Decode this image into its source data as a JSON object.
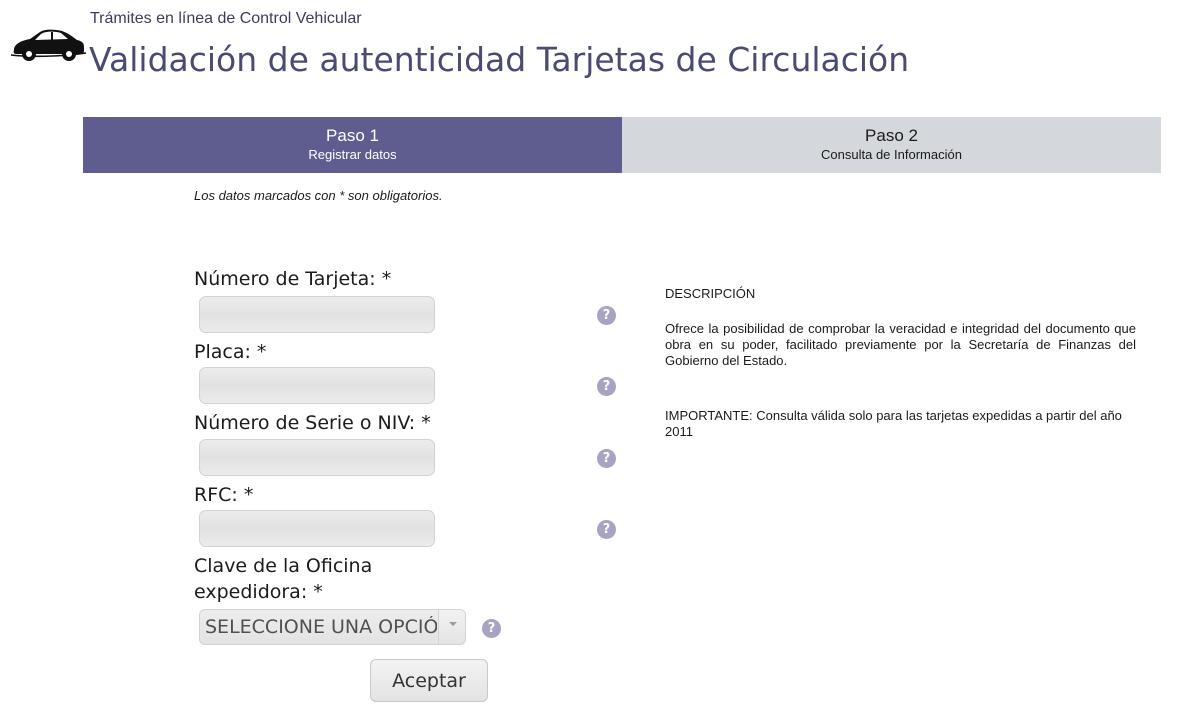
{
  "header": {
    "supertitle": "Trámites en línea de Control Vehicular",
    "title": "Validación de autenticidad Tarjetas de Circulación",
    "icon": "car-icon"
  },
  "steps": [
    {
      "title": "Paso 1",
      "subtitle": "Registrar datos",
      "active": true
    },
    {
      "title": "Paso 2",
      "subtitle": "Consulta de Información",
      "active": false
    }
  ],
  "form": {
    "required_note": "Los datos marcados con * son obligatorios.",
    "fields": {
      "tarjeta": {
        "label": "Número de Tarjeta: *",
        "value": ""
      },
      "placa": {
        "label": "Placa: *",
        "value": ""
      },
      "serie": {
        "label": "Número de Serie o NIV: *",
        "value": ""
      },
      "rfc": {
        "label": "RFC: *",
        "value": ""
      }
    },
    "oficina": {
      "label_line1": "Clave de la Oficina",
      "label_line2": "expedidora: *",
      "selected": "SELECCIONE UNA OPCIÓN"
    },
    "submit_label": "Aceptar",
    "help_glyph": "?"
  },
  "description": {
    "heading": "DESCRIPCIÓN",
    "body": "Ofrece la posibilidad de comprobar la veracidad e integridad del documento que obra en su poder, facilitado previamente por la Secretaría de Finanzas del Gobierno del Estado.",
    "important": "IMPORTANTE: Consulta válida solo para las tarjetas expedidas a partir del año 2011"
  },
  "colors": {
    "accent": "#5f5d8f",
    "title": "#4a4a72",
    "inactive_step": "#d4d7db",
    "help_icon": "#a7a3c3"
  }
}
